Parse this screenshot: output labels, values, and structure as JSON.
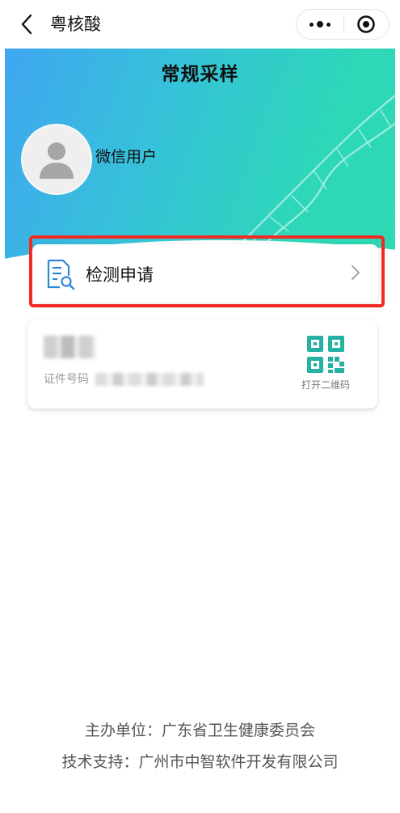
{
  "nav": {
    "title": "粤核酸"
  },
  "hero": {
    "title": "常规采样",
    "username": "微信用户"
  },
  "apply": {
    "label": "检测申请"
  },
  "id_card": {
    "id_label": "证件号码",
    "qr_label": "打开二维码"
  },
  "footer": {
    "sponsor": "主办单位：广东省卫生健康委员会",
    "support": "技术支持：广州市中智软件开发有限公司"
  },
  "colors": {
    "hero_start": "#3fa6f0",
    "hero_end": "#2ed9b2",
    "highlight": "#f22a24",
    "icon_blue": "#2f86d6",
    "qr_teal": "#26b1a5"
  },
  "icons": {
    "back": "chevron-left-icon",
    "more": "more-dots-icon",
    "close": "target-circle-icon",
    "avatar": "user-silhouette-icon",
    "apply": "document-search-icon",
    "arrow": "chevron-right-icon",
    "qr": "qr-code-icon"
  }
}
